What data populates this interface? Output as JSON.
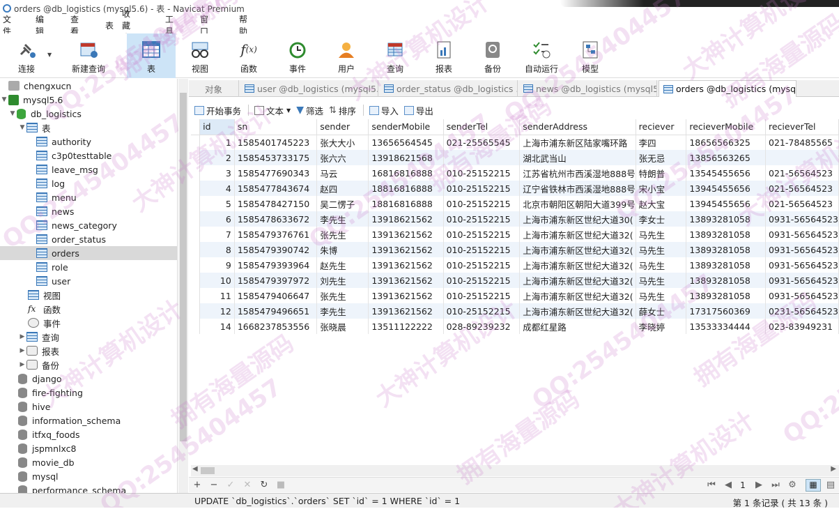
{
  "window": {
    "title": "orders @db_logistics (mysql5.6) - 表 - Navicat Premium"
  },
  "menu": [
    "文件",
    "编辑",
    "查看",
    "表",
    "收藏夹",
    "工具",
    "窗口",
    "帮助"
  ],
  "toolbar": {
    "items": [
      {
        "label": "连接",
        "icon": "connection-plug-icon"
      },
      {
        "label": "新建查询",
        "icon": "new-query-icon"
      },
      {
        "label": "表",
        "icon": "table-icon"
      },
      {
        "label": "视图",
        "icon": "view-glasses-icon"
      },
      {
        "label": "函数",
        "icon": "function-fx-icon"
      },
      {
        "label": "事件",
        "icon": "event-clock-icon"
      },
      {
        "label": "用户",
        "icon": "user-icon"
      },
      {
        "label": "查询",
        "icon": "query-icon"
      },
      {
        "label": "报表",
        "icon": "report-icon"
      },
      {
        "label": "备份",
        "icon": "backup-icon"
      },
      {
        "label": "自动运行",
        "icon": "automation-icon"
      },
      {
        "label": "模型",
        "icon": "model-icon"
      }
    ]
  },
  "sidebar": {
    "connection": "chengxucn",
    "server": "mysql5.6",
    "database": "db_logistics",
    "tables_group": "表",
    "tables": [
      "authority",
      "c3p0testtable",
      "leave_msg",
      "log",
      "menu",
      "news",
      "news_category",
      "order_status",
      "orders",
      "role",
      "user"
    ],
    "selected_table": "orders",
    "other_groups": [
      "视图",
      "函数",
      "事件",
      "查询",
      "报表",
      "备份"
    ],
    "databases": [
      "django",
      "fire-fighting",
      "hive",
      "information_schema",
      "itfxq_foods",
      "jspmnlxc8",
      "movie_db",
      "mysql",
      "performance_schema"
    ]
  },
  "tabs": [
    {
      "label": "对象"
    },
    {
      "label": "user @db_logistics (mysql5...."
    },
    {
      "label": "order_status @db_logistics ..."
    },
    {
      "label": "news @db_logistics (mysql5..."
    },
    {
      "label": "orders @db_logistics (mysq..."
    }
  ],
  "grid_toolbar": {
    "begin_transaction": "开始事务",
    "text": "文本",
    "filter": "筛选",
    "sort": "排序",
    "import": "导入",
    "export": "导出"
  },
  "grid": {
    "columns": [
      "id",
      "sn",
      "sender",
      "senderMobile",
      "senderTel",
      "senderAddress",
      "reciever",
      "recieverMobile",
      "recieverTel"
    ],
    "rows": [
      [
        "1",
        "1585401745223",
        "张大大小",
        "13656564545",
        "021-25565545",
        "上海市浦东新区陆家嘴环路",
        "李四",
        "18656566325",
        "021-78485565"
      ],
      [
        "2",
        "1585453733175",
        "张六六",
        "13918621568",
        "",
        "湖北武当山",
        "张无忌",
        "13856563265",
        ""
      ],
      [
        "3",
        "1585477690343",
        "马云",
        "16816816888",
        "010-25152215",
        "江苏省杭州市西溪湿地888号",
        "特朗普",
        "13545455656",
        "021-56564523"
      ],
      [
        "4",
        "1585477843674",
        "赵四",
        "18816816888",
        "010-25152215",
        "辽宁省铁林市西溪湿地888号",
        "宋小宝",
        "13945455656",
        "021-56564523"
      ],
      [
        "5",
        "1585478427150",
        "吴二愣子",
        "18816816888",
        "010-25152215",
        "北京市朝阳区朝阳大道399号",
        "赵大宝",
        "13945455656",
        "021-56564523"
      ],
      [
        "6",
        "1585478633672",
        "李先生",
        "13918621562",
        "010-25152215",
        "上海市浦东新区世纪大道30(",
        "李女士",
        "13893281058",
        "0931-56564523"
      ],
      [
        "7",
        "1585479376761",
        "张先生",
        "13913621562",
        "010-25152215",
        "上海市浦东新区世纪大道32(",
        "马先生",
        "13893281058",
        "0931-56564523"
      ],
      [
        "8",
        "1585479390742",
        "朱博",
        "13913621562",
        "010-25152215",
        "上海市浦东新区世纪大道32(",
        "马先生",
        "13893281058",
        "0931-56564523"
      ],
      [
        "9",
        "1585479393964",
        "赵先生",
        "13913621562",
        "010-25152215",
        "上海市浦东新区世纪大道32(",
        "马先生",
        "13893281058",
        "0931-56564523"
      ],
      [
        "10",
        "1585479397972",
        "刘先生",
        "13913621562",
        "010-25152215",
        "上海市浦东新区世纪大道32(",
        "马先生",
        "13893281058",
        "0931-56564523"
      ],
      [
        "11",
        "1585479406647",
        "张先生",
        "13913621562",
        "010-25152215",
        "上海市浦东新区世纪大道32(",
        "马先生",
        "13893281058",
        "0931-56564523"
      ],
      [
        "12",
        "1585479496651",
        "李先生",
        "13913621562",
        "010-25152215",
        "上海市浦东新区世纪大道32(",
        "薛女士",
        "17317560369",
        "0231-56564523"
      ],
      [
        "14",
        "1668237853556",
        "张晓晨",
        "13511122222",
        "028-89239232",
        "成都红星路",
        "李晓婷",
        "13533334444",
        "023-83949231"
      ]
    ]
  },
  "pager": {
    "page": "1"
  },
  "status": {
    "sql": "UPDATE `db_logistics`.`orders` SET `id` = 1 WHERE `id` = 1",
    "count": "第 1 条记录 ( 共 13 条 )"
  },
  "watermarks": [
    "QQ:2545404457",
    "大神计算机设计",
    "拥有海量源码"
  ]
}
